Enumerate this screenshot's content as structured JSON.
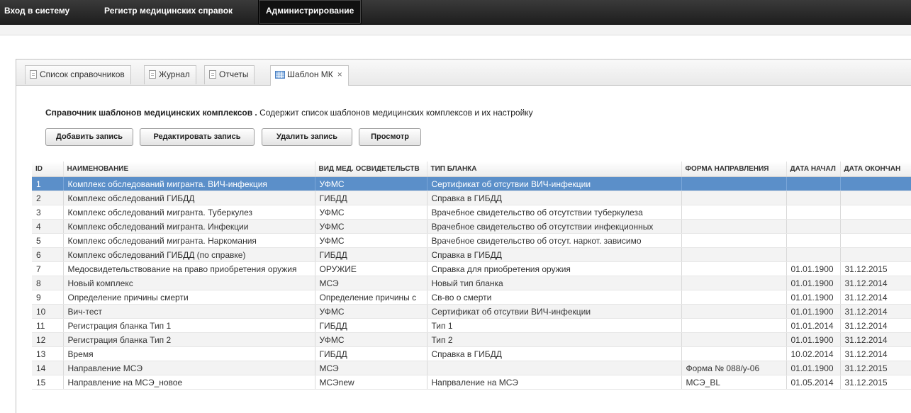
{
  "top_menu": [
    {
      "label": "Вход в систему"
    },
    {
      "label": "Регистр медицинских справок"
    },
    {
      "label": "Администрирование"
    }
  ],
  "tabs": [
    {
      "label": "Список справочников"
    },
    {
      "label": "Журнал"
    },
    {
      "label": "Отчеты"
    },
    {
      "label": "Шаблон МК",
      "close": "×"
    }
  ],
  "description": {
    "title": "Справочник шаблонов медицинских комплексов .",
    "text": " Содержит список шаблонов медицинских комплексов и их настройку"
  },
  "toolbar": {
    "add_label": "Добавить запись",
    "edit_label": "Редактировать запись",
    "delete_label": "Удалить запись",
    "view_label": "Просмотр"
  },
  "table": {
    "columns": [
      "ID",
      "НАИМЕНОВАНИЕ",
      "ВИД МЕД. ОСВИДЕТЕЛЬСТВ",
      "ТИП БЛАНКА",
      "ФОРМА НАПРАВЛЕНИЯ",
      "ДАТА НАЧАЛ",
      "ДАТА ОКОНЧАН"
    ],
    "selected_row": 0,
    "rows": [
      [
        "1",
        "Комплекс обследований мигранта. ВИЧ-инфекция",
        "УФМС",
        "Сертификат об отсутвии ВИЧ-инфекции",
        "",
        "",
        ""
      ],
      [
        "2",
        "Комплекс обследований ГИБДД",
        "ГИБДД",
        "Справка в ГИБДД",
        "",
        "",
        ""
      ],
      [
        "3",
        "Комплекс обследований мигранта. Туберкулез",
        "УФМС",
        "Врачебное свидетельство об отсутствии туберкулеза",
        "",
        "",
        ""
      ],
      [
        "4",
        "Комплекс обследований мигранта. Инфекции",
        "УФМС",
        "Врачебное свидетельство об отсутствии инфекционных",
        "",
        "",
        ""
      ],
      [
        "5",
        "Комплекс обследований мигранта. Наркомания",
        "УФМС",
        "Врачебное свидетельство об отсут. наркот. зависимо",
        "",
        "",
        ""
      ],
      [
        "6",
        "Комплекс обследований ГИБДД (по справке)",
        "ГИБДД",
        "Справка в ГИБДД",
        "",
        "",
        ""
      ],
      [
        "7",
        "Медосвидетельствование на право приобретения оружия",
        "ОРУЖИЕ",
        "Справка для приобретения оружия",
        "",
        "01.01.1900",
        "31.12.2015"
      ],
      [
        "8",
        "Новый комплекс",
        "МСЭ",
        "Новый тип бланка",
        "",
        "01.01.1900",
        "31.12.2014"
      ],
      [
        "9",
        "Определение причины смерти",
        "Определение причины с",
        "Св-во о смерти",
        "",
        "01.01.1900",
        "31.12.2014"
      ],
      [
        "10",
        "Вич-тест",
        "УФМС",
        "Сертификат об отсутвии ВИЧ-инфекции",
        "",
        "01.01.1900",
        "31.12.2014"
      ],
      [
        "11",
        "Регистрация бланка Тип 1",
        "ГИБДД",
        "Тип 1",
        "",
        "01.01.2014",
        "31.12.2014"
      ],
      [
        "12",
        "Регистрация бланка Тип 2",
        "УФМС",
        "Тип 2",
        "",
        "01.01.1900",
        "31.12.2014"
      ],
      [
        "13",
        "Время",
        "ГИБДД",
        "Справка в ГИБДД",
        "",
        "10.02.2014",
        "31.12.2014"
      ],
      [
        "14",
        "Направление МСЭ",
        "МСЭ",
        "",
        "Форма № 088/у-06",
        "01.01.1900",
        "31.12.2015"
      ],
      [
        "15",
        "Направление на МСЭ_новое",
        "МСЭnew",
        "Напрвaление на МСЭ",
        "МСЭ_BL",
        "01.05.2014",
        "31.12.2015"
      ]
    ]
  },
  "colors": {
    "selected_row": "#5b8fc9",
    "topbar": "#1e1e1e"
  }
}
